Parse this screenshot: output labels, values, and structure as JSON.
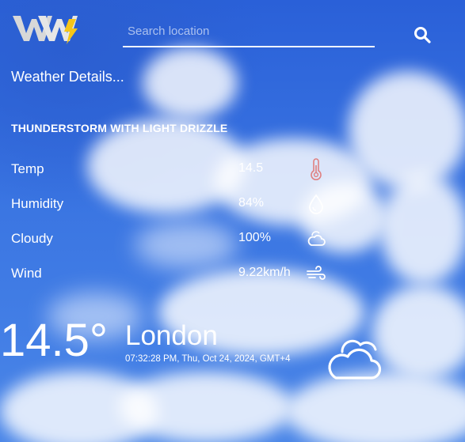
{
  "search": {
    "placeholder": "Search location",
    "value": ""
  },
  "details_heading": "Weather Details...",
  "condition": "THUNDERSTORM WITH LIGHT DRIZZLE",
  "details": [
    {
      "label": "Temp",
      "value": "14.5",
      "icon": "thermometer-icon"
    },
    {
      "label": "Humidity",
      "value": "84%",
      "icon": "droplet-icon"
    },
    {
      "label": "Cloudy",
      "value": "100%",
      "icon": "cloud-icon"
    },
    {
      "label": "Wind",
      "value": "9.22km/h",
      "icon": "wind-icon"
    }
  ],
  "current": {
    "temperature": "14.5°",
    "city": "London",
    "datetime": "07:32:28 PM, Thu, Oct 24, 2024, GMT+4",
    "icon": "partly-cloudy-icon"
  },
  "colors": {
    "sky": "#2f63d3",
    "thermometer": "#e08080",
    "text": "#ffffff"
  }
}
